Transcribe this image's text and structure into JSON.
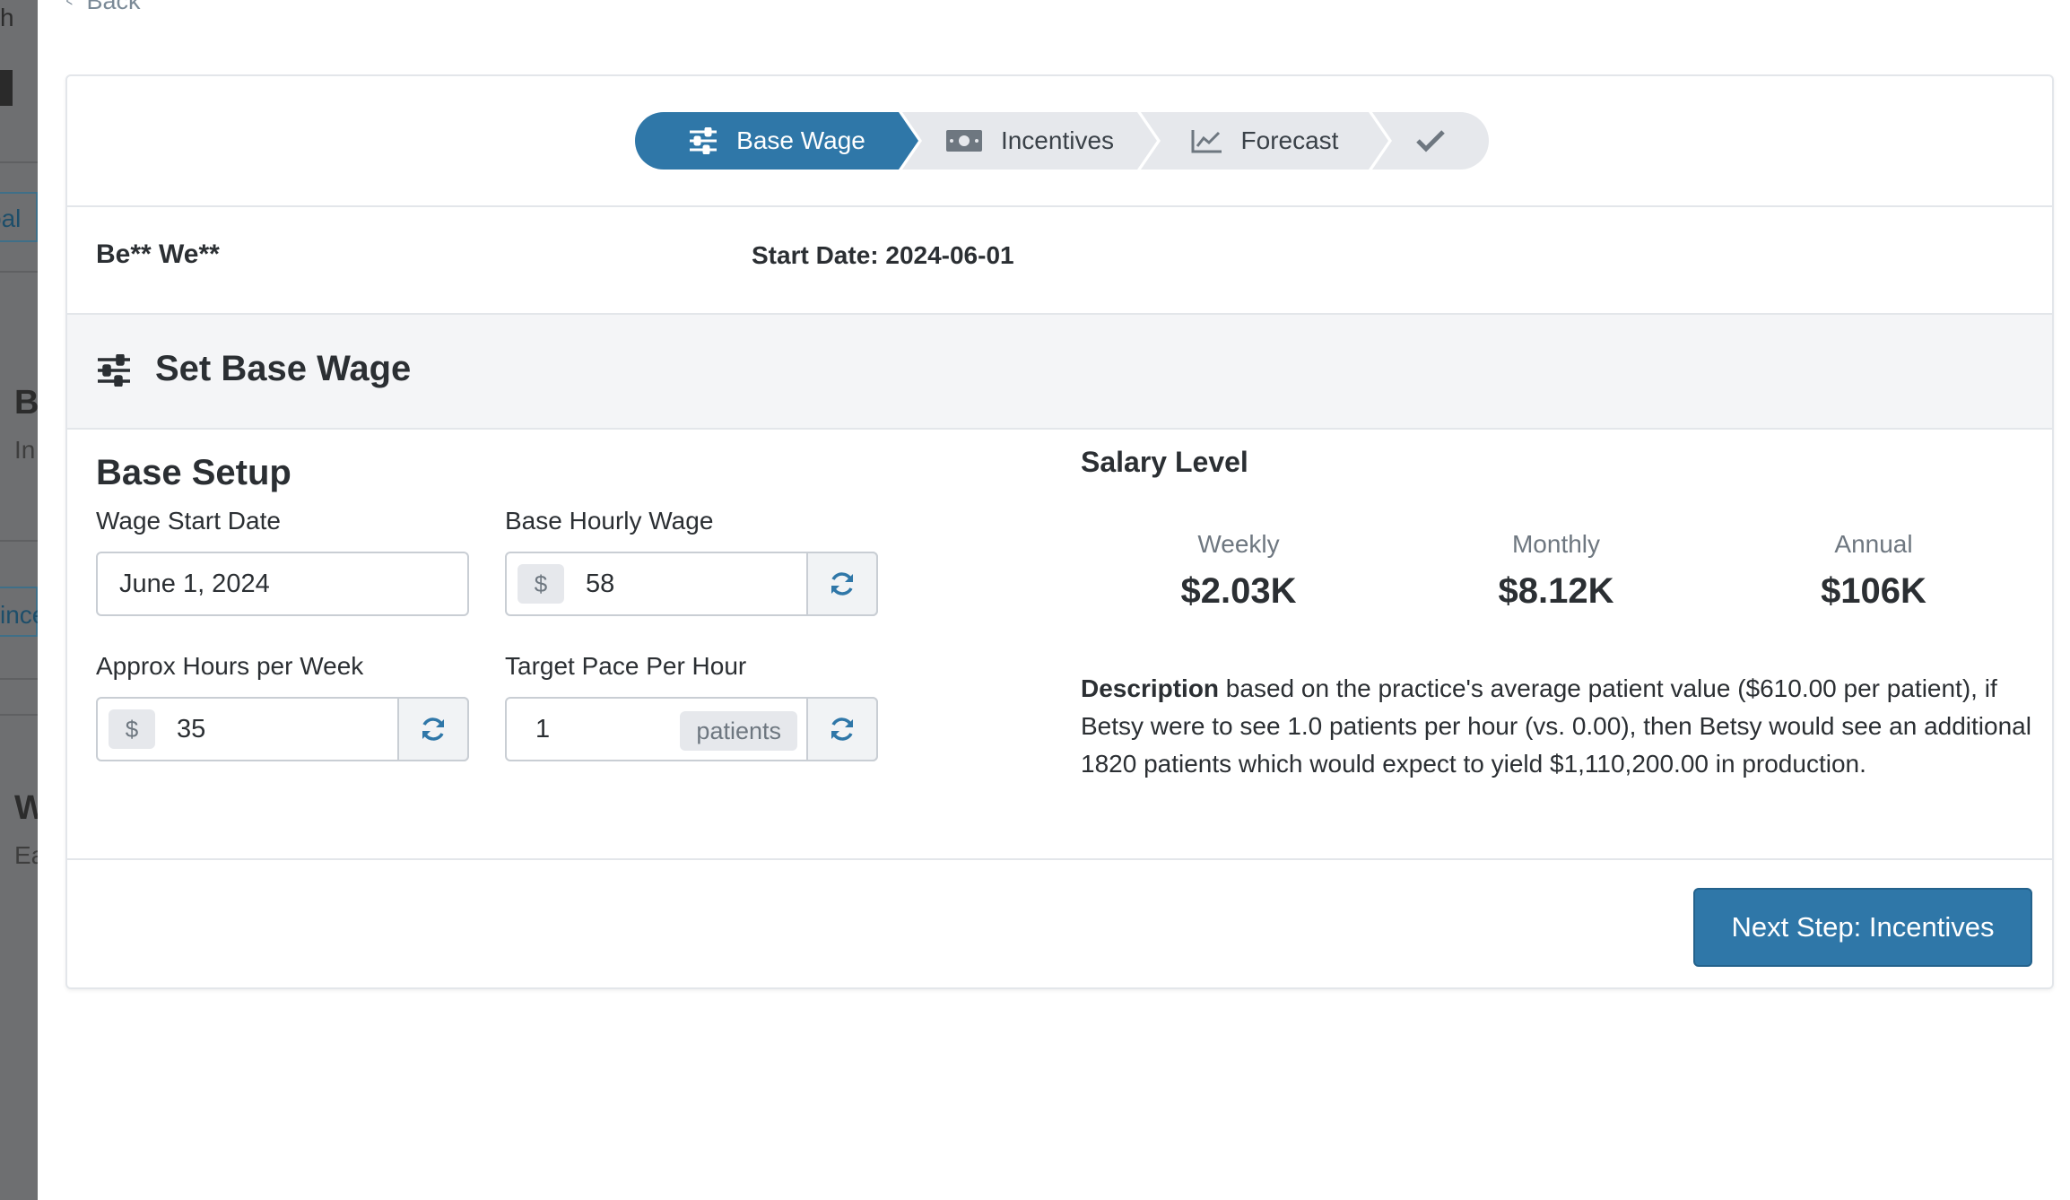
{
  "background_fragments": [
    "h",
    "bal",
    "B",
    "In",
    "ince",
    "W",
    "Ea"
  ],
  "back_link": {
    "label": "Back"
  },
  "stepper": {
    "steps": [
      {
        "label": "Base Wage",
        "icon": "sliders-icon",
        "active": true
      },
      {
        "label": "Incentives",
        "icon": "money-bill-icon",
        "active": false
      },
      {
        "label": "Forecast",
        "icon": "line-chart-icon",
        "active": false
      },
      {
        "label": "",
        "icon": "check-icon",
        "active": false
      }
    ]
  },
  "employee": {
    "name": "Be** We**",
    "start_date": "Start Date: 2024-06-01"
  },
  "section": {
    "title": "Set Base Wage",
    "icon": "sliders-icon"
  },
  "base_setup": {
    "title": "Base Setup",
    "wage_start_date": {
      "label": "Wage Start Date",
      "value": "June 1, 2024"
    },
    "base_hourly_wage": {
      "label": "Base Hourly Wage",
      "prefix": "$",
      "value": "58"
    },
    "approx_hours": {
      "label": "Approx Hours per Week",
      "prefix": "$",
      "value": "35"
    },
    "target_pace": {
      "label": "Target Pace Per Hour",
      "value": "1",
      "suffix": "patients"
    }
  },
  "salary_level": {
    "title": "Salary Level",
    "items": [
      {
        "label": "Weekly",
        "value": "$2.03K"
      },
      {
        "label": "Monthly",
        "value": "$8.12K"
      },
      {
        "label": "Annual",
        "value": "$106K"
      }
    ],
    "description_label": "Description",
    "description_text": " based on the practice's average patient value ($610.00 per patient), if Betsy were to see 1.0 patients per hour (vs. 0.00), then Betsy would see an additional 1820 patients which would expect to yield $1,110,200.00 in production."
  },
  "next_button": {
    "label": "Next Step: Incentives"
  },
  "colors": {
    "primary": "#2f77a8",
    "step_inactive": "#e6e8ec",
    "section_bg": "#f4f5f7",
    "border": "#e3e6ea"
  }
}
